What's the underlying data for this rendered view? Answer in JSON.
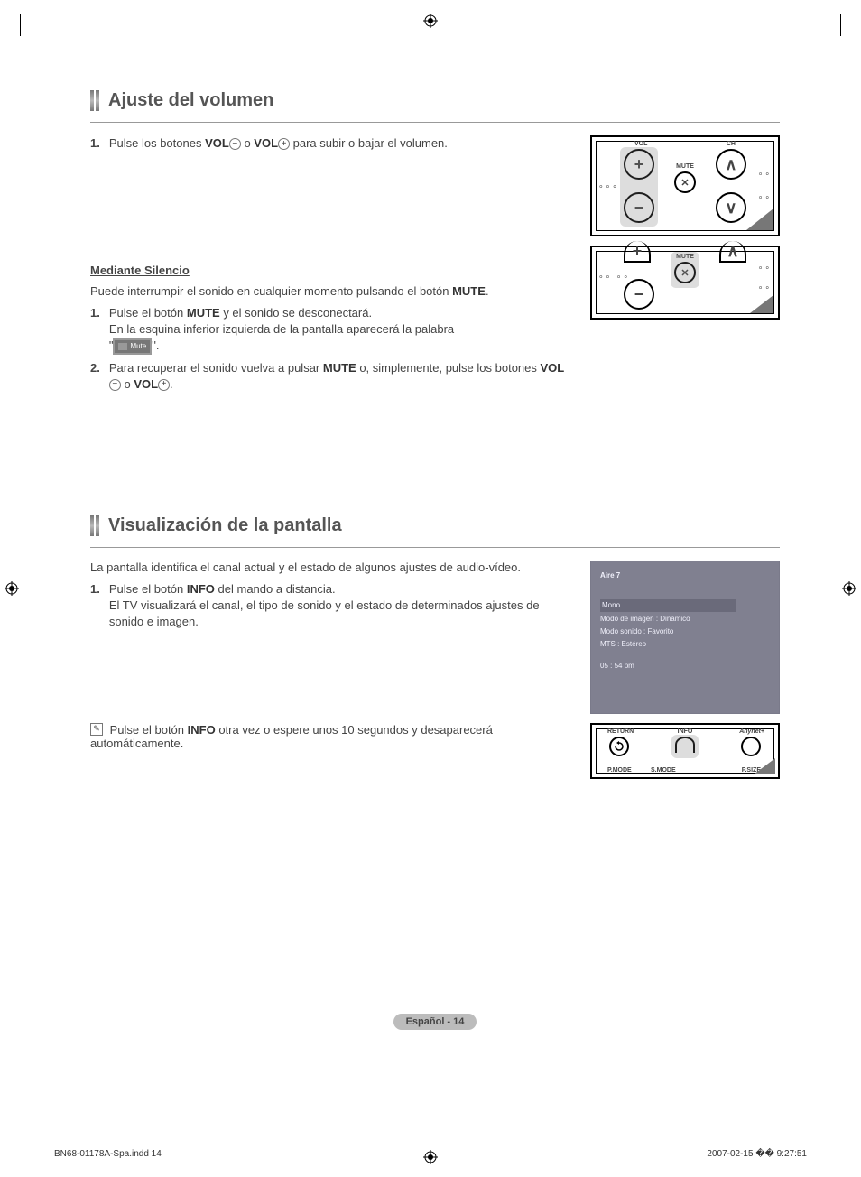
{
  "section1": {
    "title": "Ajuste del volumen",
    "item1_num": "1.",
    "item1_a": "Pulse los botones ",
    "item1_vol1": "VOL",
    "item1_b": " o ",
    "item1_vol2": "VOL",
    "item1_c": " para subir o bajar el volumen.",
    "remote": {
      "vol": "VOL",
      "ch": "CH",
      "mute": "MUTE"
    }
  },
  "silence": {
    "title": "Mediante Silencio",
    "intro_a": "Puede interrumpir el sonido en cualquier momento pulsando el botón ",
    "intro_mute": "MUTE",
    "intro_b": ".",
    "i1_num": "1.",
    "i1_a": "Pulse el botón ",
    "i1_mute": "MUTE",
    "i1_b": " y el sonido se desconectará.",
    "i1_c": "En la esquina inferior izquierda de la pantalla aparecerá la palabra",
    "i1_badge": "Mute",
    "i2_num": "2.",
    "i2_a": "Para recuperar el sonido vuelva a pulsar ",
    "i2_mute": "MUTE",
    "i2_b": " o, simplemente, pulse los botones ",
    "i2_vol1": "VOL",
    "i2_c": " o ",
    "i2_vol2": "VOL",
    "i2_d": ".",
    "remote": {
      "mute": "MUTE"
    }
  },
  "section2": {
    "title": "Visualización de la pantalla",
    "intro": "La pantalla identifica el canal actual y el estado de algunos ajustes de audio-vídeo.",
    "i1_num": "1.",
    "i1_a": "Pulse el botón ",
    "i1_info": "INFO",
    "i1_b": " del mando a distancia.",
    "i1_c": "El TV visualizará el canal, el tipo de sonido y el estado de determinados ajustes de sonido e imagen.",
    "note_a": "Pulse el botón ",
    "note_info": "INFO",
    "note_b": " otra vez o espere unos 10 segundos y desaparecerá automáticamente.",
    "osd": {
      "channel": "Aire 7",
      "mono": "Mono",
      "r1": "Modo de imagen : Dinámico",
      "r2": "Modo sonido : Favorito",
      "r3": "MTS : Estéreo",
      "time": "05 : 54 pm"
    },
    "remote": {
      "return": "RETURN",
      "info": "INFO",
      "pmode": "P.MODE",
      "smode": "S.MODE",
      "psize": "P.SIZE"
    }
  },
  "footer": {
    "badge": "Español - 14",
    "file": "BN68-01178A-Spa.indd   14",
    "date": "2007-02-15   �� 9:27:51"
  }
}
